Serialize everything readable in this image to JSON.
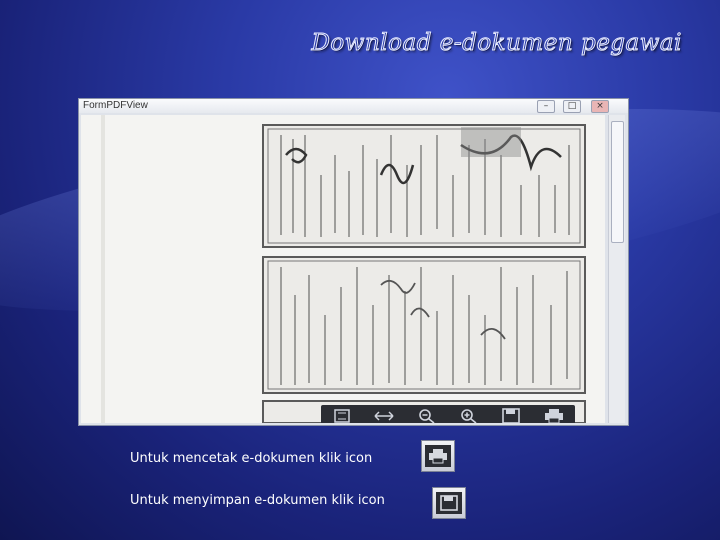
{
  "slide": {
    "title": "Download e-dokumen pegawai"
  },
  "window": {
    "title": "FormPDFView",
    "buttons": [
      "–",
      "□",
      "×"
    ]
  },
  "toolbar": {
    "buttons": [
      "fit-page-icon",
      "fit-width-icon",
      "zoom-out-icon",
      "zoom-in-icon",
      "save-icon",
      "print-icon"
    ]
  },
  "captions": {
    "print": "Untuk mencetak e-dokumen klik icon",
    "save": "Untuk menyimpan e-dokumen klik icon"
  }
}
